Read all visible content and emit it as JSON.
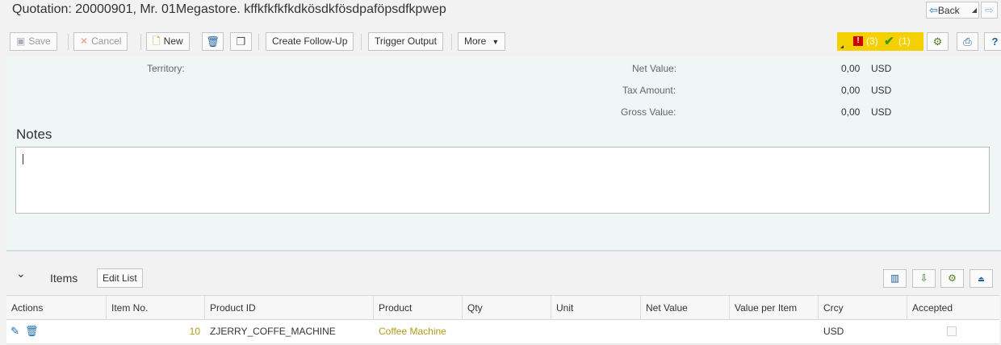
{
  "title": "Quotation: 20000901, Mr. 01Megastore. kffkfkfkfkdkösdkfösdpaföpsdfkpwep",
  "nav": {
    "back_label": "Back"
  },
  "toolbar": {
    "save_label": "Save",
    "cancel_label": "Cancel",
    "new_label": "New",
    "create_followup_label": "Create Follow-Up",
    "trigger_output_label": "Trigger Output",
    "more_label": "More",
    "messages": {
      "errors": "(3)",
      "successes": "(1)",
      "badge_color": "#f5d000"
    }
  },
  "header": {
    "territory_label": "Territory:",
    "net_value_label": "Net Value:",
    "net_value": "0,00",
    "net_value_currency": "USD",
    "tax_amount_label": "Tax Amount:",
    "tax_amount": "0,00",
    "tax_amount_currency": "USD",
    "gross_value_label": "Gross Value:",
    "gross_value": "0,00",
    "gross_value_currency": "USD"
  },
  "notes": {
    "heading": "Notes",
    "value": ""
  },
  "items": {
    "title": "Items",
    "edit_list_label": "Edit List",
    "columns": [
      "Actions",
      "Item No.",
      "Product ID",
      "Product",
      "Qty",
      "Unit",
      "Net Value",
      "Value per Item",
      "Crcy",
      "Accepted"
    ],
    "rows": [
      {
        "item_no": "10",
        "product_id": "ZJERRY_COFFE_MACHINE",
        "product": "Coffee Machine",
        "qty": "",
        "unit": "",
        "net_value": "",
        "value_per_item": "",
        "crcy": "USD",
        "accepted": false
      }
    ]
  },
  "colors": {
    "link": "#b39a16",
    "panel_bg": "#eef6f6",
    "accent": "#1a6fb0"
  }
}
